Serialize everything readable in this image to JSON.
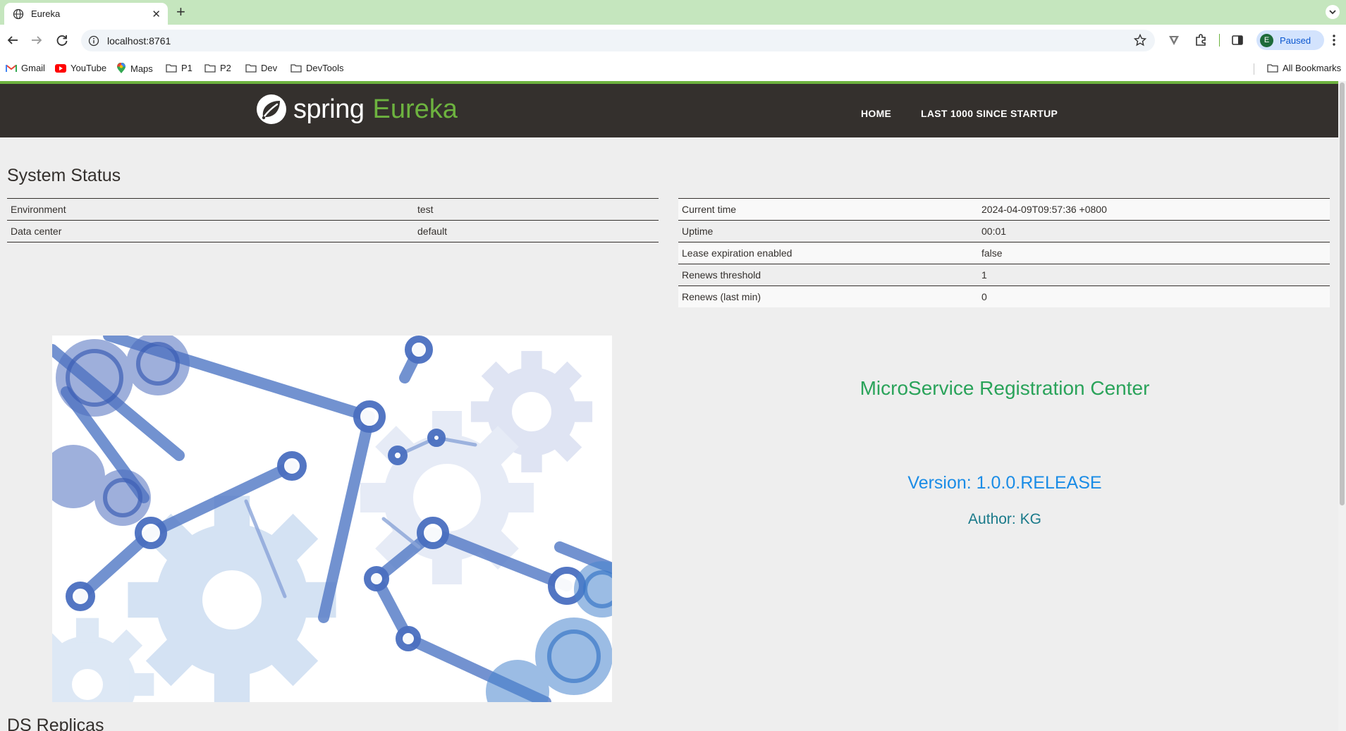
{
  "browser": {
    "tab": {
      "title": "Eureka",
      "favicon": "globe-icon"
    },
    "address": {
      "url": "localhost:8761"
    },
    "profile": {
      "initial": "E",
      "status": "Paused"
    },
    "bookmarks": [
      {
        "label": "Gmail",
        "icon": "gmail-icon"
      },
      {
        "label": "YouTube",
        "icon": "youtube-icon"
      },
      {
        "label": "Maps",
        "icon": "maps-icon"
      },
      {
        "label": "P1",
        "icon": "folder-icon"
      },
      {
        "label": "P2",
        "icon": "folder-icon"
      },
      {
        "label": "Dev",
        "icon": "folder-icon"
      },
      {
        "label": "DevTools",
        "icon": "folder-icon"
      }
    ],
    "all_bookmarks": "All Bookmarks"
  },
  "eureka": {
    "brand": {
      "spring": "spring",
      "eureka": "Eureka"
    },
    "nav": {
      "home": "HOME",
      "last1000": "LAST 1000 SINCE STARTUP"
    },
    "colors": {
      "header_bg": "#34302d",
      "brand_green": "#6db33f"
    }
  },
  "system_status": {
    "title": "System Status",
    "left": [
      {
        "key": "Environment",
        "value": "test"
      },
      {
        "key": "Data center",
        "value": "default"
      }
    ],
    "right": [
      {
        "key": "Current time",
        "value": "2024-04-09T09:57:36 +0800"
      },
      {
        "key": "Uptime",
        "value": "00:01"
      },
      {
        "key": "Lease expiration enabled",
        "value": "false"
      },
      {
        "key": "Renews threshold",
        "value": "1"
      },
      {
        "key": "Renews (last min)",
        "value": "0"
      }
    ]
  },
  "info": {
    "title": "MicroService Registration Center",
    "version": "Version: 1.0.0.RELEASE",
    "author": "Author: KG"
  },
  "replicas": {
    "title": "DS Replicas"
  }
}
